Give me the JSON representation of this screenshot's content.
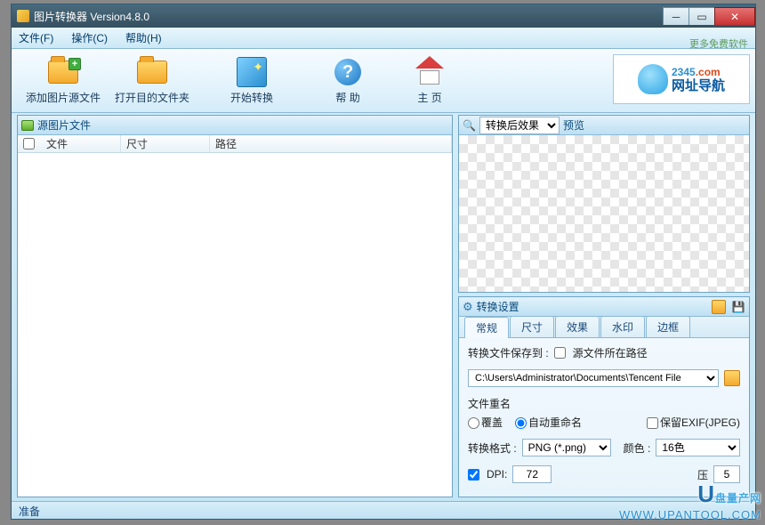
{
  "window": {
    "title": "图片转换器 Version4.8.0"
  },
  "menu": {
    "file": "文件(F)",
    "action": "操作(C)",
    "help": "帮助(H)"
  },
  "toolbar": {
    "add_source": "添加图片源文件",
    "open_dest": "打开目的文件夹",
    "start": "开始转换",
    "help": "帮 助",
    "home": "主 页",
    "more_link": "更多免费软件"
  },
  "banner": {
    "line1a": "2345",
    "line1b": ".com",
    "line2": "网址导航"
  },
  "source_panel": {
    "title": "源图片文件",
    "cols": {
      "file": "文件",
      "size": "尺寸",
      "path": "路径"
    }
  },
  "preview_panel": {
    "effect_label": "转换后效果",
    "preview_label": "预览"
  },
  "settings_panel": {
    "title": "转换设置",
    "tabs": [
      "常规",
      "尺寸",
      "效果",
      "水印",
      "边框"
    ],
    "active_tab": 0,
    "save_to_label": "转换文件保存到 :",
    "same_as_source": "源文件所在路径",
    "save_path": "C:\\Users\\Administrator\\Documents\\Tencent File",
    "rename_group": "文件重名",
    "overwrite": "覆盖",
    "auto_rename": "自动重命名",
    "keep_exif": "保留EXIF(JPEG)",
    "format_label": "转换格式 :",
    "format_value": "PNG (*.png)",
    "color_label": "颜色 :",
    "color_value": "16色",
    "dpi_label": "DPI:",
    "dpi_value": "72",
    "compress_label": "压",
    "compress_value": "5"
  },
  "status": {
    "text": "准备"
  },
  "watermark": {
    "brand": "盘量产网",
    "url": "WWW.UPANTOOL.COM"
  }
}
